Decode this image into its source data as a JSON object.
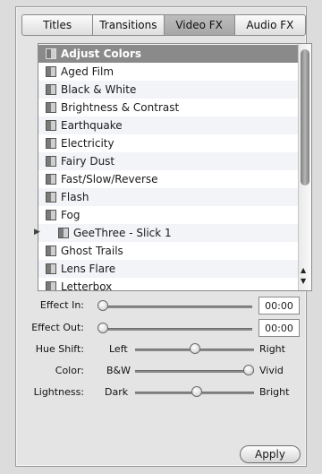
{
  "tabs": [
    {
      "label": "Titles",
      "selected": false
    },
    {
      "label": "Transitions",
      "selected": false
    },
    {
      "label": "Video FX",
      "selected": true
    },
    {
      "label": "Audio FX",
      "selected": false
    }
  ],
  "effects_list": [
    {
      "label": "Adjust Colors",
      "selected": true
    },
    {
      "label": "Aged Film"
    },
    {
      "label": "Black & White"
    },
    {
      "label": "Brightness & Contrast"
    },
    {
      "label": "Earthquake"
    },
    {
      "label": "Electricity"
    },
    {
      "label": "Fairy Dust"
    },
    {
      "label": "Fast/Slow/Reverse"
    },
    {
      "label": "Flash"
    },
    {
      "label": "Fog"
    },
    {
      "label": "GeeThree - Slick 1",
      "disclosure": true
    },
    {
      "label": "Ghost Trails"
    },
    {
      "label": "Lens Flare"
    },
    {
      "label": "Letterbox"
    }
  ],
  "effect_in": {
    "label": "Effect In:",
    "value": "00:00"
  },
  "effect_out": {
    "label": "Effect Out:",
    "value": "00:00"
  },
  "hue_shift": {
    "label": "Hue Shift:",
    "min_label": "Left",
    "max_label": "Right",
    "level": 0.5
  },
  "color": {
    "label": "Color:",
    "min_label": "B&W",
    "max_label": "Vivid",
    "level": 1.0
  },
  "lightness": {
    "label": "Lightness:",
    "min_label": "Dark",
    "max_label": "Bright",
    "level": 0.5
  },
  "apply_button": "Apply",
  "icons": {
    "effect_icon": "effect-thumbnail-icon",
    "disclosure": "disclosure-triangle-icon",
    "scroll_up": "scroll-up-arrow-icon",
    "scroll_down": "scroll-down-arrow-icon"
  }
}
